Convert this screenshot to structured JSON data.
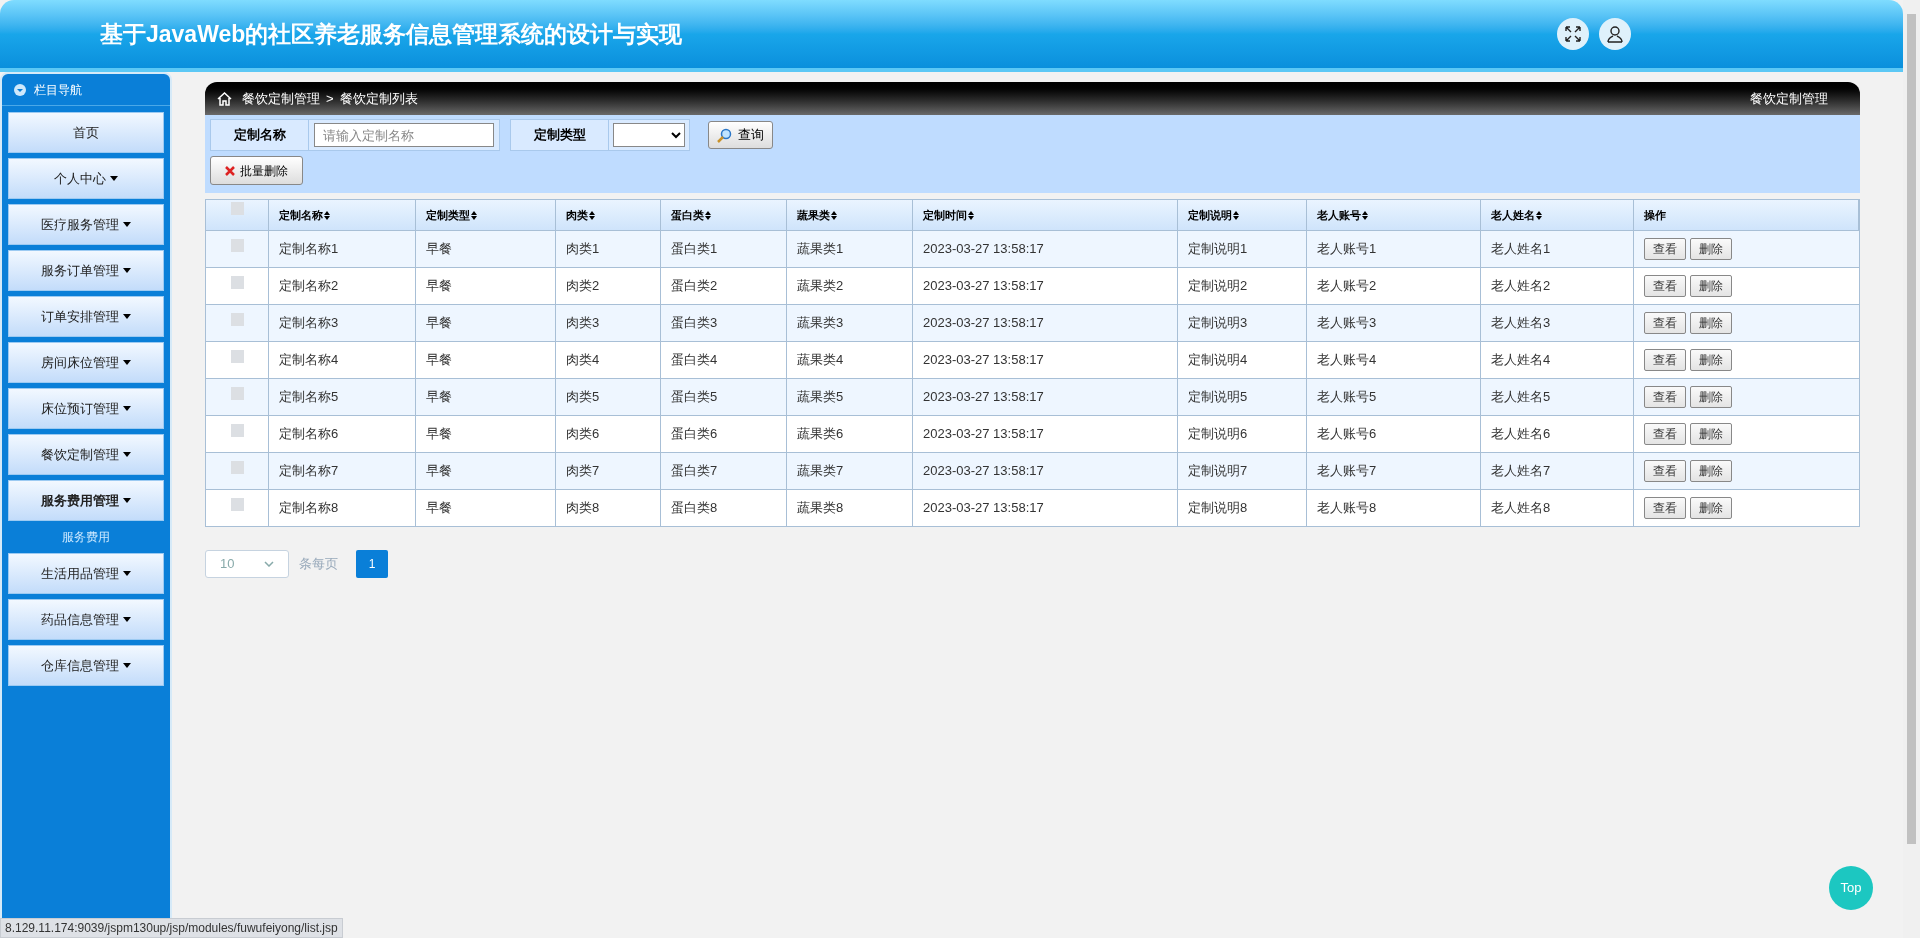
{
  "header": {
    "title": "基于JavaWeb的社区养老服务信息管理系统的设计与实现"
  },
  "sidebar": {
    "title": "栏目导航",
    "items": [
      {
        "label": "首页",
        "has_caret": false,
        "expanded": false
      },
      {
        "label": "个人中心",
        "has_caret": true,
        "expanded": false
      },
      {
        "label": "医疗服务管理",
        "has_caret": true,
        "expanded": false
      },
      {
        "label": "服务订单管理",
        "has_caret": true,
        "expanded": false
      },
      {
        "label": "订单安排管理",
        "has_caret": true,
        "expanded": false
      },
      {
        "label": "房间床位管理",
        "has_caret": true,
        "expanded": false
      },
      {
        "label": "床位预订管理",
        "has_caret": true,
        "expanded": false
      },
      {
        "label": "餐饮定制管理",
        "has_caret": true,
        "expanded": false
      },
      {
        "label": "服务费用管理",
        "has_caret": true,
        "expanded": true,
        "children": [
          {
            "label": "服务费用"
          }
        ]
      },
      {
        "label": "生活用品管理",
        "has_caret": true,
        "expanded": false
      },
      {
        "label": "药品信息管理",
        "has_caret": true,
        "expanded": false
      },
      {
        "label": "仓库信息管理",
        "has_caret": true,
        "expanded": false
      }
    ]
  },
  "breadcrumb": {
    "items": [
      "餐饮定制管理",
      "餐饮定制列表"
    ],
    "separator": ">",
    "right_title": "餐饮定制管理"
  },
  "search": {
    "name_label": "定制名称",
    "name_placeholder": "请输入定制名称",
    "type_label": "定制类型",
    "search_button": "查询",
    "batch_delete_button": "批量删除"
  },
  "table": {
    "all_checked": false,
    "columns": [
      {
        "label": "定制名称",
        "sortable": true
      },
      {
        "label": "定制类型",
        "sortable": true
      },
      {
        "label": "肉类",
        "sortable": true
      },
      {
        "label": "蛋白类",
        "sortable": true
      },
      {
        "label": "蔬果类",
        "sortable": true
      },
      {
        "label": "定制时间",
        "sortable": true
      },
      {
        "label": "定制说明",
        "sortable": true
      },
      {
        "label": "老人账号",
        "sortable": true
      },
      {
        "label": "老人姓名",
        "sortable": true
      },
      {
        "label": "操作",
        "sortable": false
      }
    ],
    "rows": [
      {
        "checked": false,
        "cells": [
          "定制名称1",
          "早餐",
          "肉类1",
          "蛋白类1",
          "蔬果类1",
          "2023-03-27 13:58:17",
          "定制说明1",
          "老人账号1",
          "老人姓名1"
        ],
        "actions": [
          "查看",
          "删除"
        ]
      },
      {
        "checked": false,
        "cells": [
          "定制名称2",
          "早餐",
          "肉类2",
          "蛋白类2",
          "蔬果类2",
          "2023-03-27 13:58:17",
          "定制说明2",
          "老人账号2",
          "老人姓名2"
        ],
        "actions": [
          "查看",
          "删除"
        ]
      },
      {
        "checked": false,
        "cells": [
          "定制名称3",
          "早餐",
          "肉类3",
          "蛋白类3",
          "蔬果类3",
          "2023-03-27 13:58:17",
          "定制说明3",
          "老人账号3",
          "老人姓名3"
        ],
        "actions": [
          "查看",
          "删除"
        ]
      },
      {
        "checked": false,
        "cells": [
          "定制名称4",
          "早餐",
          "肉类4",
          "蛋白类4",
          "蔬果类4",
          "2023-03-27 13:58:17",
          "定制说明4",
          "老人账号4",
          "老人姓名4"
        ],
        "actions": [
          "查看",
          "删除"
        ]
      },
      {
        "checked": false,
        "cells": [
          "定制名称5",
          "早餐",
          "肉类5",
          "蛋白类5",
          "蔬果类5",
          "2023-03-27 13:58:17",
          "定制说明5",
          "老人账号5",
          "老人姓名5"
        ],
        "actions": [
          "查看",
          "删除"
        ]
      },
      {
        "checked": false,
        "cells": [
          "定制名称6",
          "早餐",
          "肉类6",
          "蛋白类6",
          "蔬果类6",
          "2023-03-27 13:58:17",
          "定制说明6",
          "老人账号6",
          "老人姓名6"
        ],
        "actions": [
          "查看",
          "删除"
        ]
      },
      {
        "checked": false,
        "cells": [
          "定制名称7",
          "早餐",
          "肉类7",
          "蛋白类7",
          "蔬果类7",
          "2023-03-27 13:58:17",
          "定制说明7",
          "老人账号7",
          "老人姓名7"
        ],
        "actions": [
          "查看",
          "删除"
        ]
      },
      {
        "checked": false,
        "cells": [
          "定制名称8",
          "早餐",
          "肉类8",
          "蛋白类8",
          "蔬果类8",
          "2023-03-27 13:58:17",
          "定制说明8",
          "老人账号8",
          "老人姓名8"
        ],
        "actions": [
          "查看",
          "删除"
        ]
      }
    ]
  },
  "pagination": {
    "page_size": "10",
    "page_size_label": "条每页",
    "pages": [
      {
        "label": "1",
        "selected": true
      }
    ]
  },
  "top_button": "Top",
  "status_bar": {
    "url": "8.129.11.174:9039/jspm130up/jsp/modules/fuwufeiyong/list.jsp"
  }
}
